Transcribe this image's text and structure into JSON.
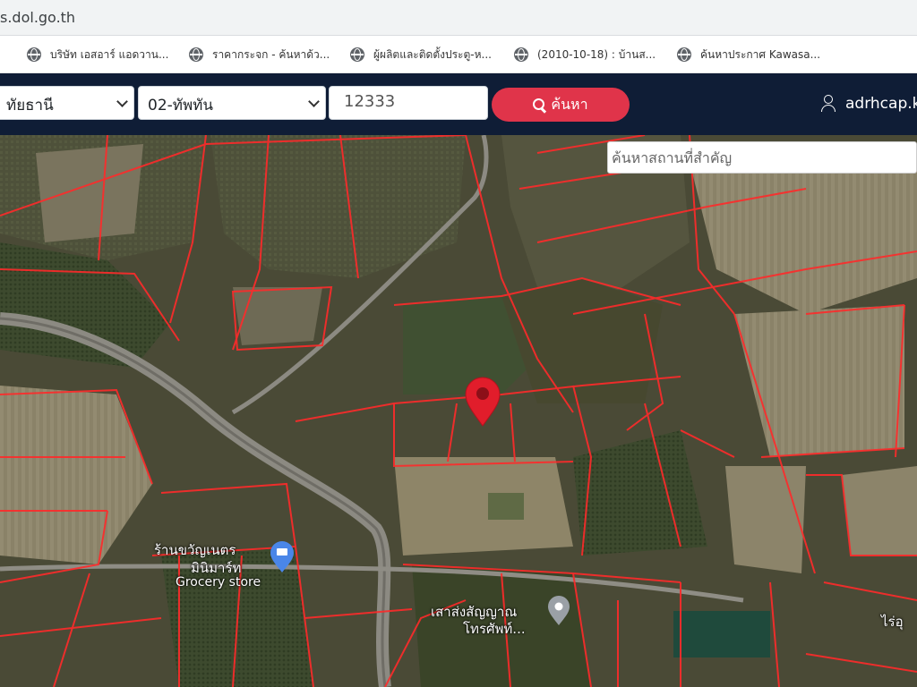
{
  "browser": {
    "url": "s.dol.go.th",
    "bookmarks": [
      "บริษัท เอสอาร์ แอดวาน...",
      "ราคากระจก - ค้นหาด้ว...",
      "ผู้ผลิตและติดตั้งประตู-ห...",
      "(2010-10-18) : บ้านส...",
      "ค้นหาประกาศ Kawasa..."
    ]
  },
  "search_bar": {
    "province": "ทัยธานี",
    "district": "02-ทัพทัน",
    "parcel_number": "12333",
    "search_label": "ค้นหา",
    "user_name": "adrhcap.k"
  },
  "map": {
    "place_search_placeholder": "ค้นหาสถานที่สำคัญ",
    "labels": {
      "shop_name_line1": "ร้านขวัญเนตร",
      "shop_name_line2": "มินิมาร์ท",
      "grocery": "Grocery store",
      "shrine_line1": "เสาส่งสัญญาณ",
      "shrine_line2": "โทรศัพท์...",
      "right_edge": "ไร่อุ"
    },
    "colors": {
      "parcel_line": "#ff2a2a",
      "marker": "#e11d2b",
      "poi_blue": "#4a86e8",
      "poi_gray": "#9aa0a6"
    }
  }
}
